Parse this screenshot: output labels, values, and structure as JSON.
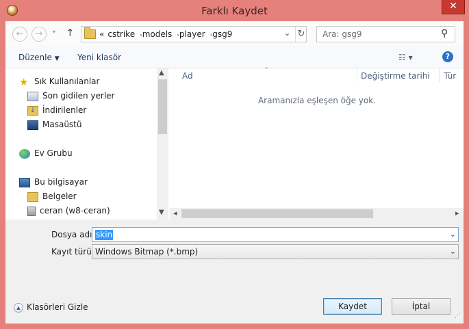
{
  "window": {
    "title": "Farklı Kaydet",
    "close_label": "✕"
  },
  "nav": {
    "back_glyph": "←",
    "forward_glyph": "→",
    "recent_glyph": "▾",
    "up_glyph": "↑",
    "breadcrumb_prefix": "«",
    "breadcrumbs": [
      "cstrike",
      "models",
      "player",
      "gsg9"
    ],
    "refresh_glyph": "↻",
    "search_placeholder": "Ara: gsg9"
  },
  "toolbar": {
    "organize_label": "Düzenle",
    "new_folder_label": "Yeni klasör",
    "views_glyph": "☷ ▾",
    "help_glyph": "?"
  },
  "sidebar": {
    "items": [
      {
        "label": "Sık Kullanılanlar",
        "icon": "star-icon"
      },
      {
        "label": "Son gidilen yerler",
        "icon": "recent-places-icon"
      },
      {
        "label": "İndirilenler",
        "icon": "downloads-folder-icon"
      },
      {
        "label": "Masaüstü",
        "icon": "desktop-icon"
      },
      {
        "label": "Ev Grubu",
        "icon": "homegroup-icon"
      },
      {
        "label": "Bu bilgisayar",
        "icon": "computer-icon"
      },
      {
        "label": "Belgeler",
        "icon": "documents-folder-icon"
      },
      {
        "label": "ceran (w8-ceran)",
        "icon": "network-drive-icon"
      }
    ]
  },
  "file_list": {
    "columns": [
      "Ad",
      "Değiştirme tarihi",
      "Tür"
    ],
    "empty_message": "Aramanızla eşleşen öğe yok."
  },
  "form": {
    "filename_label": "Dosya adı:",
    "filename_value": "skin",
    "filetype_label": "Kayıt türü:",
    "filetype_value": "Windows Bitmap (*.bmp)",
    "hide_folders_label": "Klasörleri Gizle",
    "save_label": "Kaydet",
    "cancel_label": "İptal"
  },
  "colors": {
    "title_bar": "#e6807b",
    "close_button": "#c7392f",
    "selection": "#3399ff"
  }
}
